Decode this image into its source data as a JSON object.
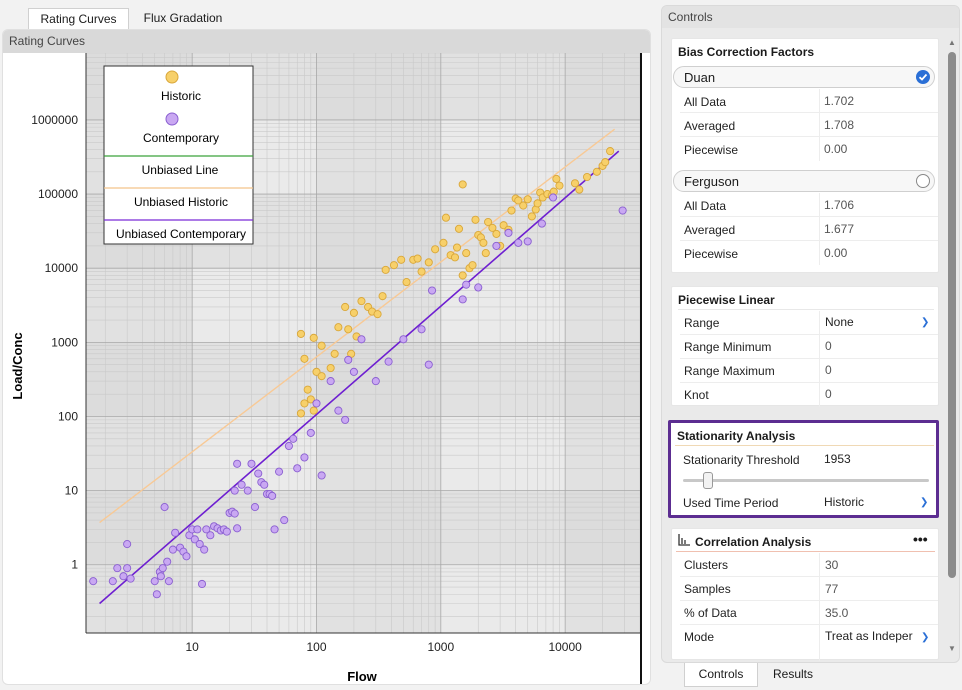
{
  "tabs": [
    {
      "label": "Rating Curves",
      "active": true
    },
    {
      "label": "Flux Gradation",
      "active": false
    }
  ],
  "plot_panel": {
    "title": "Rating Curves"
  },
  "chart_data": {
    "type": "scatter",
    "xlabel": "Flow",
    "ylabel": "Load/Conc",
    "xscale": "log",
    "yscale": "log",
    "xlim": [
      1.4,
      40000
    ],
    "ylim": [
      0.12,
      8000000
    ],
    "x_ticks": [
      "10",
      "100",
      "1000",
      "10000"
    ],
    "y_ticks": [
      "1",
      "10",
      "100",
      "1000",
      "10000",
      "100000",
      "1000000"
    ],
    "grid": true,
    "legend_placement": "top-left",
    "legend": [
      {
        "label": "Historic",
        "kind": "marker",
        "color": "#f7d06a",
        "stroke": "#d9a73a"
      },
      {
        "label": "Contemporary",
        "kind": "marker",
        "color": "#c9a8f2",
        "stroke": "#8a5fd0"
      },
      {
        "label": "Unbiased Line",
        "kind": "line",
        "color": "#3aa23a"
      },
      {
        "label": "Unbiased Historic",
        "kind": "line",
        "color": "#f3c48a"
      },
      {
        "label": "Unbiased Contemporary",
        "kind": "line",
        "color": "#7b2bd6"
      }
    ],
    "lines": [
      {
        "name": "Unbiased Historic",
        "color": "#f8c995",
        "x": [
          1.8,
          25000
        ],
        "y": [
          3.7,
          750000
        ]
      },
      {
        "name": "Unbiased Contemporary",
        "color": "#6e1fd1",
        "x": [
          1.8,
          27000
        ],
        "y": [
          0.3,
          380000
        ]
      }
    ],
    "series": [
      {
        "name": "Historic",
        "color": "#f7d06a",
        "stroke": "#d9a73a",
        "points": [
          [
            75,
            1300
          ],
          [
            95,
            1150
          ],
          [
            110,
            900
          ],
          [
            80,
            600
          ],
          [
            85,
            230
          ],
          [
            90,
            170
          ],
          [
            80,
            150
          ],
          [
            95,
            120
          ],
          [
            75,
            110
          ],
          [
            100,
            400
          ],
          [
            110,
            350
          ],
          [
            130,
            450
          ],
          [
            140,
            700
          ],
          [
            150,
            1600
          ],
          [
            170,
            3000
          ],
          [
            180,
            1500
          ],
          [
            190,
            700
          ],
          [
            200,
            2500
          ],
          [
            210,
            1200
          ],
          [
            230,
            3600
          ],
          [
            260,
            3000
          ],
          [
            280,
            2600
          ],
          [
            310,
            2400
          ],
          [
            340,
            4200
          ],
          [
            360,
            9500
          ],
          [
            420,
            11000
          ],
          [
            480,
            13000
          ],
          [
            530,
            6500
          ],
          [
            600,
            13000
          ],
          [
            650,
            13500
          ],
          [
            700,
            9000
          ],
          [
            800,
            12000
          ],
          [
            900,
            18000
          ],
          [
            1100,
            48000
          ],
          [
            1050,
            22000
          ],
          [
            1200,
            15000
          ],
          [
            1300,
            14000
          ],
          [
            1350,
            19000
          ],
          [
            1500,
            8000
          ],
          [
            1600,
            16000
          ],
          [
            1700,
            10000
          ],
          [
            1800,
            11000
          ],
          [
            1900,
            45000
          ],
          [
            2000,
            28000
          ],
          [
            2100,
            26000
          ],
          [
            2200,
            22000
          ],
          [
            2300,
            16000
          ],
          [
            2400,
            42000
          ],
          [
            2600,
            35000
          ],
          [
            2800,
            29000
          ],
          [
            3000,
            20000
          ],
          [
            3200,
            38000
          ],
          [
            3500,
            33000
          ],
          [
            3700,
            60000
          ],
          [
            4000,
            87000
          ],
          [
            4200,
            82000
          ],
          [
            4600,
            70000
          ],
          [
            5000,
            85000
          ],
          [
            5400,
            50000
          ],
          [
            5800,
            62000
          ],
          [
            6000,
            75000
          ],
          [
            6300,
            105000
          ],
          [
            6600,
            90000
          ],
          [
            7200,
            100000
          ],
          [
            7800,
            95000
          ],
          [
            8100,
            108000
          ],
          [
            8500,
            160000
          ],
          [
            9000,
            130000
          ],
          [
            1500,
            135000
          ],
          [
            1400,
            34000
          ],
          [
            18000,
            200000
          ],
          [
            20000,
            240000
          ],
          [
            21000,
            270000
          ],
          [
            23000,
            380000
          ],
          [
            15000,
            170000
          ],
          [
            12000,
            140000
          ],
          [
            13000,
            115000
          ]
        ]
      },
      {
        "name": "Contemporary",
        "color": "#c9a8f2",
        "stroke": "#8a5fd0",
        "points": [
          [
            1.6,
            0.6
          ],
          [
            2.3,
            0.6
          ],
          [
            2.5,
            0.9
          ],
          [
            2.8,
            0.7
          ],
          [
            3,
            1.9
          ],
          [
            3.2,
            0.65
          ],
          [
            3,
            0.9
          ],
          [
            5,
            0.6
          ],
          [
            5.2,
            0.4
          ],
          [
            5.5,
            0.8
          ],
          [
            5.6,
            0.7
          ],
          [
            5.8,
            0.9
          ],
          [
            6,
            6
          ],
          [
            6.3,
            1.1
          ],
          [
            6.5,
            0.6
          ],
          [
            7,
            1.6
          ],
          [
            7.3,
            2.7
          ],
          [
            8,
            1.7
          ],
          [
            8.5,
            1.5
          ],
          [
            9,
            1.3
          ],
          [
            9.5,
            2.5
          ],
          [
            10,
            3
          ],
          [
            10.5,
            2.2
          ],
          [
            11,
            3
          ],
          [
            11.5,
            1.9
          ],
          [
            12,
            0.55
          ],
          [
            12.5,
            1.6
          ],
          [
            13,
            3
          ],
          [
            14,
            2.5
          ],
          [
            15,
            3.3
          ],
          [
            16,
            3.1
          ],
          [
            17,
            2.9
          ],
          [
            18,
            3
          ],
          [
            19,
            2.8
          ],
          [
            20,
            5
          ],
          [
            21,
            5.2
          ],
          [
            22,
            4.9
          ],
          [
            23,
            3.1
          ],
          [
            22,
            10
          ],
          [
            23,
            23
          ],
          [
            25,
            12
          ],
          [
            28,
            10
          ],
          [
            30,
            23
          ],
          [
            32,
            6
          ],
          [
            34,
            17
          ],
          [
            36,
            13
          ],
          [
            38,
            12
          ],
          [
            40,
            9
          ],
          [
            42,
            9
          ],
          [
            44,
            8.5
          ],
          [
            46,
            3
          ],
          [
            50,
            18
          ],
          [
            55,
            4
          ],
          [
            60,
            40
          ],
          [
            65,
            50
          ],
          [
            70,
            20
          ],
          [
            80,
            28
          ],
          [
            90,
            60
          ],
          [
            100,
            150
          ],
          [
            110,
            16
          ],
          [
            130,
            300
          ],
          [
            150,
            120
          ],
          [
            170,
            90
          ],
          [
            180,
            580
          ],
          [
            200,
            400
          ],
          [
            230,
            1100
          ],
          [
            300,
            300
          ],
          [
            380,
            550
          ],
          [
            500,
            1100
          ],
          [
            700,
            1500
          ],
          [
            800,
            500
          ],
          [
            850,
            5000
          ],
          [
            1600,
            6000
          ],
          [
            2000,
            5500
          ],
          [
            2800,
            20000
          ],
          [
            3500,
            30000
          ],
          [
            4200,
            22000
          ],
          [
            5000,
            23000
          ],
          [
            6500,
            40000
          ],
          [
            8000,
            90000
          ],
          [
            29000,
            60000
          ],
          [
            1500,
            3800
          ]
        ]
      }
    ]
  },
  "controls": {
    "header": "Controls",
    "bias": {
      "title": "Bias Correction Factors",
      "duan": {
        "label": "Duan",
        "checked": true,
        "rows": [
          {
            "label": "All Data",
            "value": "1.702"
          },
          {
            "label": "Averaged",
            "value": "1.708"
          },
          {
            "label": "Piecewise",
            "value": "0.00"
          }
        ]
      },
      "ferguson": {
        "label": "Ferguson",
        "checked": false,
        "rows": [
          {
            "label": "All Data",
            "value": "1.706"
          },
          {
            "label": "Averaged",
            "value": "1.677"
          },
          {
            "label": "Piecewise",
            "value": "0.00"
          }
        ]
      }
    },
    "piecewise": {
      "title": "Piecewise Linear",
      "rows": [
        {
          "label": "Range",
          "value": "None",
          "dropdown": true
        },
        {
          "label": "Range Minimum",
          "value": "0"
        },
        {
          "label": "Range Maximum",
          "value": "0"
        },
        {
          "label": "Knot",
          "value": "0"
        }
      ]
    },
    "stationarity": {
      "title": "Stationarity Analysis",
      "threshold_label": "Stationarity Threshold",
      "threshold_value": "1953",
      "slider_fraction": 0.1,
      "period_label": "Used Time Period",
      "period_value": "Historic"
    },
    "correlation": {
      "title": "Correlation Analysis",
      "menu": "•••",
      "rows": [
        {
          "label": "Clusters",
          "value": "30"
        },
        {
          "label": "Samples",
          "value": "77"
        },
        {
          "label": "% of Data",
          "value": "35.0"
        },
        {
          "label": "Mode",
          "value": "Treat as Indeper",
          "dropdown": true
        }
      ]
    }
  },
  "bottom_tabs": [
    {
      "label": "Controls",
      "active": true
    },
    {
      "label": "Results",
      "active": false
    }
  ],
  "colors": {
    "accent": "#2a6fd6",
    "highlight_border": "#5c2d91"
  }
}
